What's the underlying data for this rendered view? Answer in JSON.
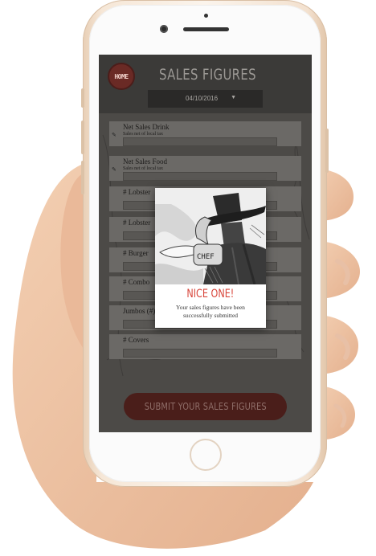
{
  "header": {
    "logo_text": "HOME",
    "title": "SALES FIGURES",
    "date_value": "04/10/2016",
    "date_arrow": "▼"
  },
  "fields": [
    {
      "label": "Net Sales Drink",
      "sub": "Sales net of local tax"
    },
    {
      "label": "Net Sales Food",
      "sub": "Sales net of local tax"
    },
    {
      "label": "# Lobster",
      "sub": ""
    },
    {
      "label": "# Lobster",
      "sub": ""
    },
    {
      "label": "# Burger",
      "sub": ""
    },
    {
      "label": "# Combo",
      "sub": ""
    },
    {
      "label": "Jumbos (#)",
      "sub": ""
    },
    {
      "label": "# Covers",
      "sub": ""
    }
  ],
  "submit_label": "SUBMIT YOUR SALES FIGURES",
  "modal": {
    "title": "NICE ONE!",
    "message": "Your sales figures have been successfully submitted",
    "knife_text": "CHEF"
  },
  "colors": {
    "accent": "#d8463b",
    "submit_bg": "#4a1e1a"
  }
}
